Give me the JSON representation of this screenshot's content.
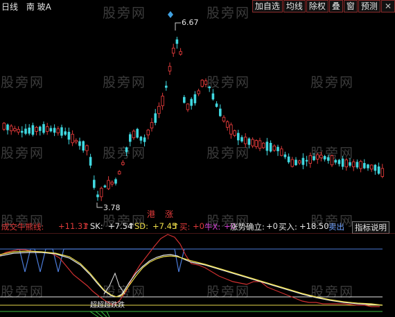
{
  "toolbar": {
    "period": "日线",
    "stock_name": "南 玻A",
    "buttons": [
      "加自选",
      "均线",
      "除权",
      "叠",
      "窗",
      "预测"
    ],
    "close_glyph": "✕"
  },
  "watermark": "股旁网",
  "price_labels": {
    "high": "6.67",
    "low": "3.78"
  },
  "chart_marks": {
    "gang": "港",
    "zhang": "涨"
  },
  "indicator": {
    "name": "成交牛熊线: ",
    "value1": "+11.31",
    "arrow1": "↑",
    "sk_label": "SK: ",
    "sk_value": "+7.54",
    "arrow2": "↑",
    "sd_label": "SD: ",
    "sd_value": "+7.45",
    "arrow3": "↑",
    "buy_label": "买: ",
    "buy_value": "+0",
    "bull_label": "牛X: ",
    "bull_value": "+0",
    "trend_label": "涨势确立: ",
    "trend_value": "+0",
    "buyin_label": "买入: ",
    "buyin_value": "+18.50",
    "sell_label": "卖出",
    "help_label": "指标说明"
  },
  "bottom_marks": "超超超跌跌",
  "colors": {
    "up": "#e03a3a",
    "down": "#40d8e0",
    "sk": "#f0e04a",
    "sd": "#f0f0f0",
    "line": "#d03030",
    "band": "#4b7bd8"
  }
}
